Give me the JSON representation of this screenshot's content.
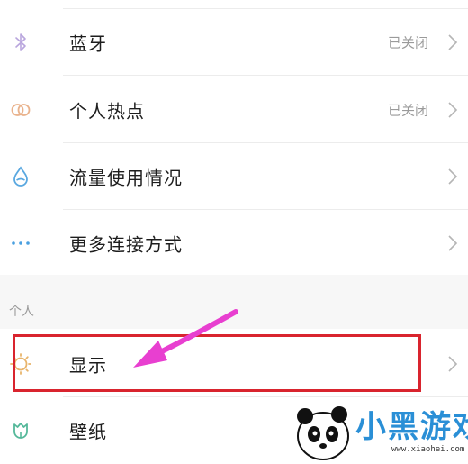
{
  "rows": [
    {
      "label": "蓝牙",
      "status": "已关闭",
      "icon": "bluetooth-icon"
    },
    {
      "label": "个人热点",
      "status": "已关闭",
      "icon": "hotspot-icon"
    },
    {
      "label": "流量使用情况",
      "status": "",
      "icon": "data-usage-icon"
    },
    {
      "label": "更多连接方式",
      "status": "",
      "icon": "more-dots-icon"
    }
  ],
  "section": {
    "label": "个人"
  },
  "personal_rows": [
    {
      "label": "显示",
      "icon": "display-sun-icon"
    },
    {
      "label": "壁纸",
      "icon": "wallpaper-tulip-icon"
    }
  ],
  "colors": {
    "bluetooth": "#b9a6dd",
    "hotspot": "#e9b28c",
    "data": "#5aa8e0",
    "dots": "#4aa0e0",
    "display": "#e8b46b",
    "wallpaper": "#55b89a",
    "highlight": "#d9242e",
    "arrow": "#e83fd0"
  },
  "watermark": {
    "text": "小黑游戏",
    "url": "www.xiaohei.com"
  }
}
